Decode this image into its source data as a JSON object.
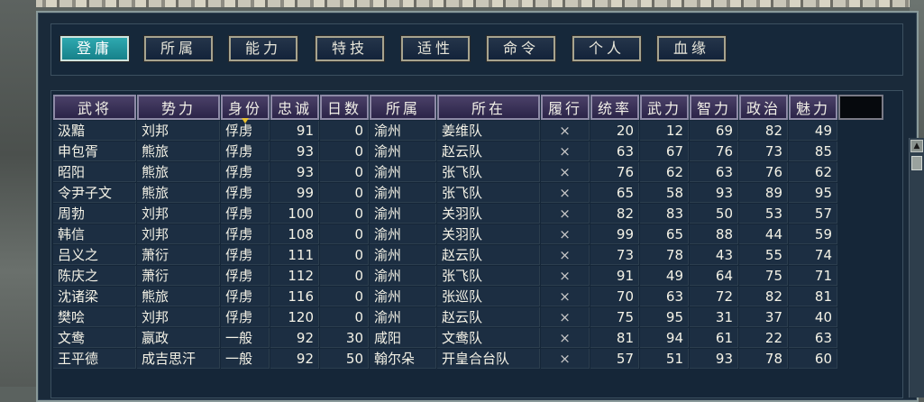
{
  "tabs": [
    "登庸",
    "所属",
    "能力",
    "特技",
    "适性",
    "命令",
    "个人",
    "血缘"
  ],
  "active_tab": 0,
  "columns": [
    "武将",
    "势力",
    "身份",
    "忠诚",
    "日数",
    "所属",
    "所在",
    "履行",
    "统率",
    "武力",
    "智力",
    "政治",
    "魅力"
  ],
  "sorted_column": "身份",
  "rows": [
    [
      "汲黯",
      "刘邦",
      "俘虏",
      "91",
      "0",
      "渝州",
      "姜维队",
      "×",
      "20",
      "12",
      "69",
      "82",
      "49"
    ],
    [
      "申包胥",
      "熊旅",
      "俘虏",
      "93",
      "0",
      "渝州",
      "赵云队",
      "×",
      "63",
      "67",
      "76",
      "73",
      "85"
    ],
    [
      "昭阳",
      "熊旅",
      "俘虏",
      "93",
      "0",
      "渝州",
      "张飞队",
      "×",
      "76",
      "62",
      "63",
      "76",
      "62"
    ],
    [
      "令尹子文",
      "熊旅",
      "俘虏",
      "99",
      "0",
      "渝州",
      "张飞队",
      "×",
      "65",
      "58",
      "93",
      "89",
      "95"
    ],
    [
      "周勃",
      "刘邦",
      "俘虏",
      "100",
      "0",
      "渝州",
      "关羽队",
      "×",
      "82",
      "83",
      "50",
      "53",
      "57"
    ],
    [
      "韩信",
      "刘邦",
      "俘虏",
      "108",
      "0",
      "渝州",
      "关羽队",
      "×",
      "99",
      "65",
      "88",
      "44",
      "59"
    ],
    [
      "吕义之",
      "萧衍",
      "俘虏",
      "111",
      "0",
      "渝州",
      "赵云队",
      "×",
      "73",
      "78",
      "43",
      "55",
      "74"
    ],
    [
      "陈庆之",
      "萧衍",
      "俘虏",
      "112",
      "0",
      "渝州",
      "张飞队",
      "×",
      "91",
      "49",
      "64",
      "75",
      "71"
    ],
    [
      "沈诸梁",
      "熊旅",
      "俘虏",
      "116",
      "0",
      "渝州",
      "张巡队",
      "×",
      "70",
      "63",
      "72",
      "82",
      "81"
    ],
    [
      "樊哙",
      "刘邦",
      "俘虏",
      "120",
      "0",
      "渝州",
      "赵云队",
      "×",
      "75",
      "95",
      "31",
      "37",
      "40"
    ],
    [
      "文鸯",
      "嬴政",
      "一般",
      "92",
      "30",
      "咸阳",
      "文鸯队",
      "×",
      "81",
      "94",
      "61",
      "22",
      "63"
    ],
    [
      "王平德",
      "成吉思汗",
      "一般",
      "92",
      "50",
      "翰尔朵",
      "开皇合台队",
      "×",
      "57",
      "51",
      "93",
      "78",
      "60"
    ]
  ]
}
